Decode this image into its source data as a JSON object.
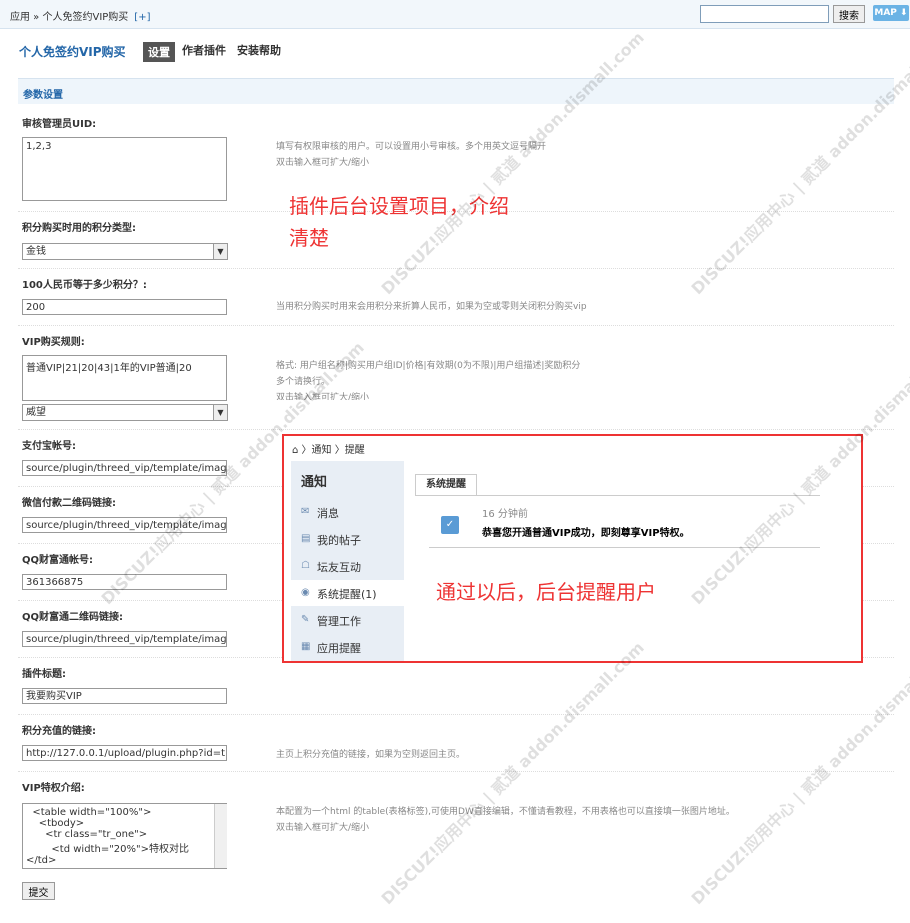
{
  "breadcrumb": {
    "text": "应用 » 个人免签约VIP购买",
    "add": "[+]"
  },
  "top": {
    "search_button": "搜索",
    "map_button": "MAP ⬇"
  },
  "header": {
    "plugin_title": "个人免签约VIP购买",
    "tabs": [
      "设置",
      "作者插件",
      "安装帮助"
    ]
  },
  "section": {
    "title": "参数设置"
  },
  "fields": {
    "uid_label": "审核管理员UID:",
    "uid_value": "1,2,3",
    "uid_hint1": "填写有权限审核的用户。可以设置用小号审核。多个用英文逗号隔开",
    "uid_hint2": "双击输入框可扩大/缩小",
    "credit_type_label": "积分购买时用的积分类型:",
    "credit_type_value": "金钱",
    "rmb_label": "100人民币等于多少积分？:",
    "rmb_value": "200",
    "rmb_hint": "当用积分购买时用来会用积分来折算人民币，如果为空或零则关闭积分购买vip",
    "vip_rule_label": "VIP购买规则:",
    "vip_rule_value": "普通VIP|21|20|43|1年的VIP普通|20",
    "vip_rule_hint1": "格式: 用户组名称|购买用户组ID|价格|有效期(0为不限)|用户组描述|奖励积分",
    "vip_rule_hint2": "多个请换行。",
    "vip_rule_hint3": "双击输入框可扩大/缩小",
    "vip_rule_select": "威望",
    "alipay_label": "支付宝帐号:",
    "alipay_value": "source/plugin/threed_vip/template/imag",
    "wechat_label": "微信付款二维码链接:",
    "wechat_value": "source/plugin/threed_vip/template/imag",
    "qq_label": "QQ财富通帐号:",
    "qq_value": "361366875",
    "qq_qr_label": "QQ财富通二维码链接:",
    "qq_qr_value": "source/plugin/threed_vip/template/imag",
    "title_label": "插件标题:",
    "title_value": "我要购买VIP",
    "recharge_label": "积分充值的链接:",
    "recharge_value": "http://127.0.0.1/upload/plugin.php?id=t",
    "recharge_hint": "主页上积分充值的链接，如果为空则返回主页。",
    "intro_label": "VIP特权介绍:",
    "intro_value": "  <table width=\"100%\">\n    <tbody>\n      <tr class=\"tr_one\">\n        <td width=\"20%\">特权对比\n</td>",
    "intro_hint1": "本配置为一个html 的table(表格标签),可使用DW直接编辑，不懂请看教程，不用表格也可以直接填一张图片地址。",
    "intro_hint2": "双击输入框可扩大/缩小"
  },
  "submit_label": "提交",
  "notes": {
    "note1": "插件后台设置项目，介绍\n清楚",
    "note2": "通过以后，后台提醒用户"
  },
  "popup": {
    "crumb": "⌂ 〉通知 〉提醒",
    "side_title": "通知",
    "items": [
      {
        "icon": "✉",
        "label": "消息"
      },
      {
        "icon": "▤",
        "label": "我的帖子"
      },
      {
        "icon": "☖",
        "label": "坛友互动"
      },
      {
        "icon": "◉",
        "label": "系统提醒(1)"
      },
      {
        "icon": "✎",
        "label": "管理工作"
      },
      {
        "icon": "▦",
        "label": "应用提醒"
      }
    ],
    "tab": "系统提醒",
    "time": "16 分钟前",
    "message": "恭喜您开通普通VIP成功，即刻尊享VIP特权。"
  },
  "watermark": "DISCUZ!应用中心 | 贰道 addon.dismall.com"
}
